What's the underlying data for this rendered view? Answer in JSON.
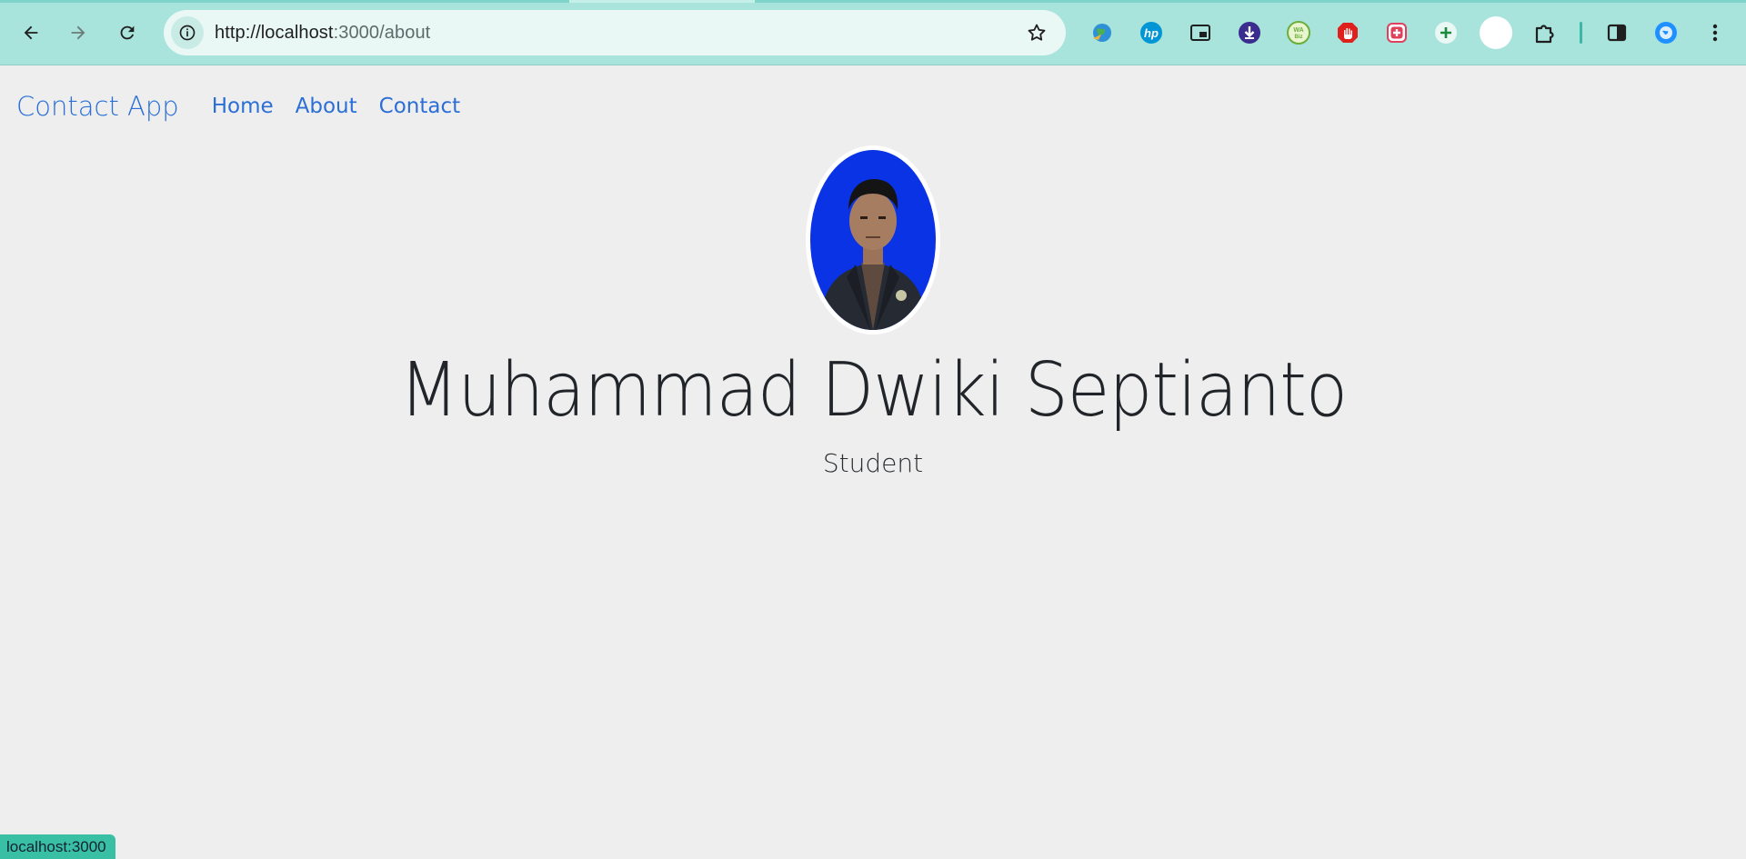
{
  "browser": {
    "url_host": "http://localhost",
    "url_rest": ":3000/about",
    "extensions": [
      "earth-globe-icon",
      "hp-icon",
      "picture-in-picture-icon",
      "download-manager-icon",
      "wa-biz-icon",
      "adblock-hand-icon",
      "medical-plus-icon",
      "add-green-icon",
      "profile-circle-icon",
      "puzzle-extensions-icon",
      "side-panel-icon",
      "vpn-globe-icon",
      "kebab-menu-icon"
    ]
  },
  "navbar": {
    "brand": "Contact App",
    "links": [
      "Home",
      "About",
      "Contact"
    ]
  },
  "profile": {
    "name": "Muhammad Dwiki Septianto",
    "role": "Student"
  },
  "status": {
    "text": "localhost:3000"
  },
  "colors": {
    "toolbar": "#a8e3dc",
    "link": "#2b6fd6",
    "page_bg": "#eeeeee",
    "status_bg": "#39bfa3"
  }
}
